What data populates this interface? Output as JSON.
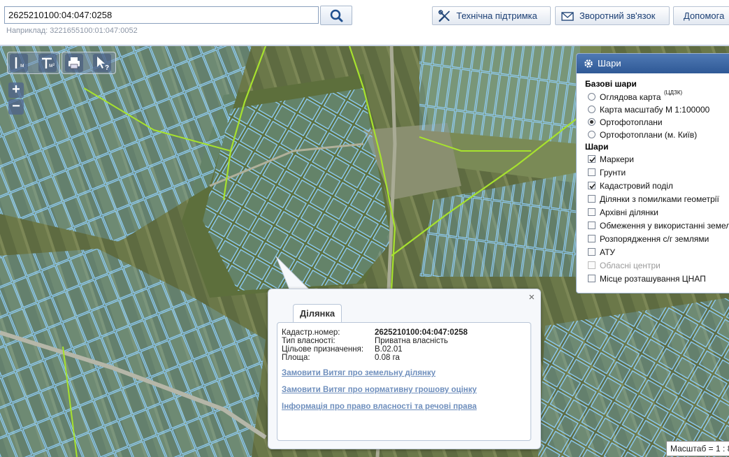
{
  "search": {
    "value": "2625210100:04:047:0258",
    "hint": "Наприклад: 3221655100:01:047:0052"
  },
  "toolbar": {
    "support_label": "Технічна підтримка",
    "feedback_label": "Зворотний зв'язок",
    "help_label": "Допомога"
  },
  "map_tools": {
    "length_sub": "м",
    "area_sub": "м²",
    "zoom_in": "+",
    "zoom_out": "−"
  },
  "layers_panel": {
    "title": "Шари",
    "base_title": "Базові шари",
    "base_layers": [
      {
        "label": "Оглядова карта",
        "sup": "(ЦДЗК)",
        "selected": false
      },
      {
        "label": "Карта масштабу М 1:100000",
        "selected": false
      },
      {
        "label": "Ортофотоплани",
        "selected": true
      },
      {
        "label": "Ортофотоплани (м. Київ)",
        "selected": false
      }
    ],
    "layers_title": "Шари",
    "layers": [
      {
        "label": "Маркери",
        "checked": true
      },
      {
        "label": "Грунти",
        "checked": false
      },
      {
        "label": "Кадастровий поділ",
        "checked": true
      },
      {
        "label": "Ділянки з помилками геометрії",
        "checked": false
      },
      {
        "label": "Архівні ділянки",
        "checked": false
      },
      {
        "label": "Обмеження у використанні земель",
        "checked": false
      },
      {
        "label": "Розпорядження с/г землями",
        "checked": false
      },
      {
        "label": "АТУ",
        "checked": false
      },
      {
        "label": "Обласні центри",
        "checked": false,
        "disabled": true
      },
      {
        "label": "Місце розташування ЦНАП",
        "checked": false
      }
    ]
  },
  "popup": {
    "close": "×",
    "tab": "Ділянка",
    "fields": [
      {
        "key": "Кадастр.номер:",
        "value": "2625210100:04:047:0258"
      },
      {
        "key": "Тип власності:",
        "value": "Приватна власність"
      },
      {
        "key": "Цільове призначення:",
        "value": "В.02.01"
      },
      {
        "key": "Площа:",
        "value": "0.08 га"
      }
    ],
    "links": [
      "Замовити Витяг про земельну ділянку",
      "Замовити Витяг про нормативну грошову оцінку",
      "Інформація про право власності та речові права"
    ]
  },
  "scale": {
    "label": "Масштаб = 1 : 8"
  }
}
